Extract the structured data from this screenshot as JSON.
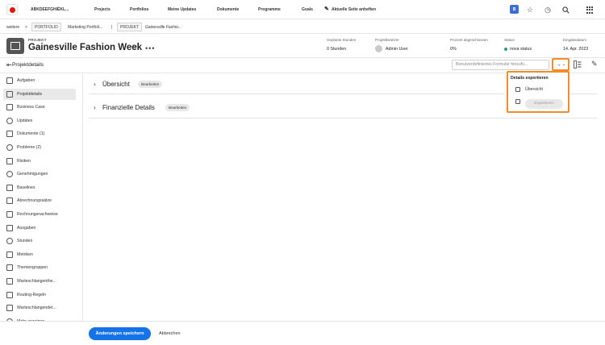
{
  "topnav": {
    "app_name": "ABKDEEFGHIÉKL...",
    "links": [
      "Projects",
      "Portfolios",
      "Meine Updates",
      "Dokumente",
      "Programme",
      "Goals"
    ],
    "pin_label": "Aktuelle Seite anheften",
    "avatar_initial": "B"
  },
  "breadcrumb": {
    "more": "weitere",
    "sep": ">",
    "portfolio_tag": "PORTFOLIO",
    "portfolio_name": "Marketing Portfoli...",
    "divider": "|",
    "project_tag": "PROJEKT",
    "project_name": "Gainesville Fashio..."
  },
  "project": {
    "type_label": "PROJEKT",
    "title": "Gainesville Fashion Week",
    "more": "•••"
  },
  "meta": {
    "planned_hours_label": "Geplante Stunden",
    "planned_hours_value": "0 Stunden",
    "owner_label": "Projektbesitzer",
    "owner_value": "Admin User",
    "percent_label": "Prozent abgeschlossen",
    "percent_value": "0%",
    "status_label": "Status",
    "status_value": "nova status",
    "status_color": "#2d9d78",
    "entry_label": "Eingabedatum",
    "entry_value": "14. Apr. 2023"
  },
  "subheader": {
    "page_title": "Projektdetails",
    "form_placeholder": "Benutzerdefiniertes Formular hinzufü..."
  },
  "sidebar": {
    "items": [
      {
        "label": "Aufgaben",
        "icon": "tasks-icon"
      },
      {
        "label": "Projektdetails",
        "icon": "details-icon",
        "active": true
      },
      {
        "label": "Business Case",
        "icon": "business-case-icon"
      },
      {
        "label": "Updates",
        "icon": "updates-icon"
      },
      {
        "label": "Dokumente (1)",
        "icon": "documents-icon"
      },
      {
        "label": "Probleme (2)",
        "icon": "issues-icon"
      },
      {
        "label": "Risiken",
        "icon": "risks-icon"
      },
      {
        "label": "Genehmigungen",
        "icon": "approvals-icon"
      },
      {
        "label": "Baselines",
        "icon": "baselines-icon"
      },
      {
        "label": "Abrechnungssätze",
        "icon": "billing-rates-icon"
      },
      {
        "label": "Rechnungsnachweise",
        "icon": "billing-records-icon"
      },
      {
        "label": "Ausgaben",
        "icon": "expenses-icon"
      },
      {
        "label": "Stunden",
        "icon": "hours-icon"
      },
      {
        "label": "Metriken",
        "icon": "metrics-icon"
      },
      {
        "label": "Themengruppen",
        "icon": "topic-groups-icon"
      },
      {
        "label": "Warteschlangenthe...",
        "icon": "queue-topics-icon"
      },
      {
        "label": "Routing-Regeln",
        "icon": "routing-rules-icon"
      },
      {
        "label": "Warteschlangendet...",
        "icon": "queue-details-icon"
      },
      {
        "label": "Mehr anzeigen",
        "icon": "more-icon"
      }
    ]
  },
  "sections": [
    {
      "title": "Übersicht",
      "edit_label": "Bearbeiten"
    },
    {
      "title": "Finanzielle Details",
      "edit_label": "Bearbeiten"
    }
  ],
  "export_popover": {
    "title": "Details exportieren",
    "option_label": "Übersicht",
    "export_label": "Exportieren"
  },
  "footer": {
    "save_label": "Änderungen speichern",
    "cancel_label": "Abbrechen"
  },
  "colors": {
    "accent": "#1473e6",
    "highlight": "#f28c28",
    "brand": "#eb1000"
  }
}
